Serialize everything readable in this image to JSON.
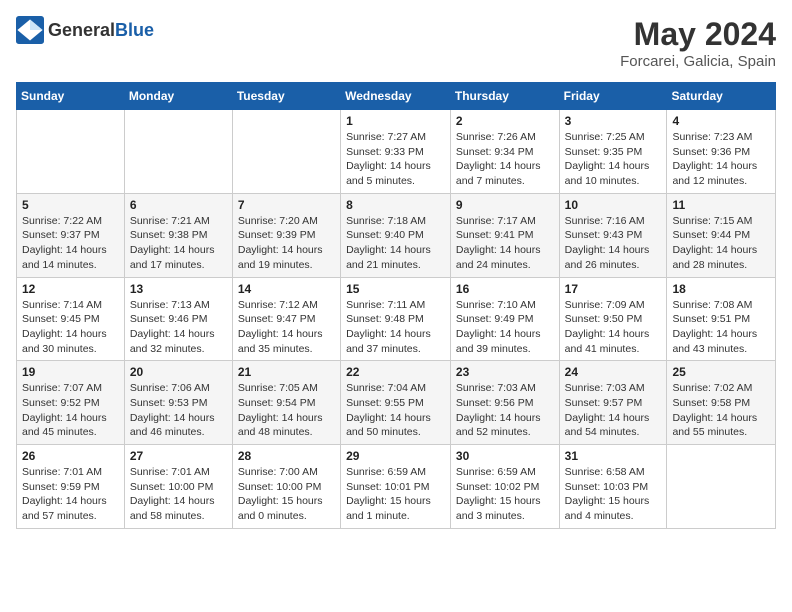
{
  "header": {
    "logo_general": "General",
    "logo_blue": "Blue",
    "month_year": "May 2024",
    "location": "Forcarei, Galicia, Spain"
  },
  "weekdays": [
    "Sunday",
    "Monday",
    "Tuesday",
    "Wednesday",
    "Thursday",
    "Friday",
    "Saturday"
  ],
  "weeks": [
    [
      {
        "day": "",
        "info": ""
      },
      {
        "day": "",
        "info": ""
      },
      {
        "day": "",
        "info": ""
      },
      {
        "day": "1",
        "info": "Sunrise: 7:27 AM\nSunset: 9:33 PM\nDaylight: 14 hours\nand 5 minutes."
      },
      {
        "day": "2",
        "info": "Sunrise: 7:26 AM\nSunset: 9:34 PM\nDaylight: 14 hours\nand 7 minutes."
      },
      {
        "day": "3",
        "info": "Sunrise: 7:25 AM\nSunset: 9:35 PM\nDaylight: 14 hours\nand 10 minutes."
      },
      {
        "day": "4",
        "info": "Sunrise: 7:23 AM\nSunset: 9:36 PM\nDaylight: 14 hours\nand 12 minutes."
      }
    ],
    [
      {
        "day": "5",
        "info": "Sunrise: 7:22 AM\nSunset: 9:37 PM\nDaylight: 14 hours\nand 14 minutes."
      },
      {
        "day": "6",
        "info": "Sunrise: 7:21 AM\nSunset: 9:38 PM\nDaylight: 14 hours\nand 17 minutes."
      },
      {
        "day": "7",
        "info": "Sunrise: 7:20 AM\nSunset: 9:39 PM\nDaylight: 14 hours\nand 19 minutes."
      },
      {
        "day": "8",
        "info": "Sunrise: 7:18 AM\nSunset: 9:40 PM\nDaylight: 14 hours\nand 21 minutes."
      },
      {
        "day": "9",
        "info": "Sunrise: 7:17 AM\nSunset: 9:41 PM\nDaylight: 14 hours\nand 24 minutes."
      },
      {
        "day": "10",
        "info": "Sunrise: 7:16 AM\nSunset: 9:43 PM\nDaylight: 14 hours\nand 26 minutes."
      },
      {
        "day": "11",
        "info": "Sunrise: 7:15 AM\nSunset: 9:44 PM\nDaylight: 14 hours\nand 28 minutes."
      }
    ],
    [
      {
        "day": "12",
        "info": "Sunrise: 7:14 AM\nSunset: 9:45 PM\nDaylight: 14 hours\nand 30 minutes."
      },
      {
        "day": "13",
        "info": "Sunrise: 7:13 AM\nSunset: 9:46 PM\nDaylight: 14 hours\nand 32 minutes."
      },
      {
        "day": "14",
        "info": "Sunrise: 7:12 AM\nSunset: 9:47 PM\nDaylight: 14 hours\nand 35 minutes."
      },
      {
        "day": "15",
        "info": "Sunrise: 7:11 AM\nSunset: 9:48 PM\nDaylight: 14 hours\nand 37 minutes."
      },
      {
        "day": "16",
        "info": "Sunrise: 7:10 AM\nSunset: 9:49 PM\nDaylight: 14 hours\nand 39 minutes."
      },
      {
        "day": "17",
        "info": "Sunrise: 7:09 AM\nSunset: 9:50 PM\nDaylight: 14 hours\nand 41 minutes."
      },
      {
        "day": "18",
        "info": "Sunrise: 7:08 AM\nSunset: 9:51 PM\nDaylight: 14 hours\nand 43 minutes."
      }
    ],
    [
      {
        "day": "19",
        "info": "Sunrise: 7:07 AM\nSunset: 9:52 PM\nDaylight: 14 hours\nand 45 minutes."
      },
      {
        "day": "20",
        "info": "Sunrise: 7:06 AM\nSunset: 9:53 PM\nDaylight: 14 hours\nand 46 minutes."
      },
      {
        "day": "21",
        "info": "Sunrise: 7:05 AM\nSunset: 9:54 PM\nDaylight: 14 hours\nand 48 minutes."
      },
      {
        "day": "22",
        "info": "Sunrise: 7:04 AM\nSunset: 9:55 PM\nDaylight: 14 hours\nand 50 minutes."
      },
      {
        "day": "23",
        "info": "Sunrise: 7:03 AM\nSunset: 9:56 PM\nDaylight: 14 hours\nand 52 minutes."
      },
      {
        "day": "24",
        "info": "Sunrise: 7:03 AM\nSunset: 9:57 PM\nDaylight: 14 hours\nand 54 minutes."
      },
      {
        "day": "25",
        "info": "Sunrise: 7:02 AM\nSunset: 9:58 PM\nDaylight: 14 hours\nand 55 minutes."
      }
    ],
    [
      {
        "day": "26",
        "info": "Sunrise: 7:01 AM\nSunset: 9:59 PM\nDaylight: 14 hours\nand 57 minutes."
      },
      {
        "day": "27",
        "info": "Sunrise: 7:01 AM\nSunset: 10:00 PM\nDaylight: 14 hours\nand 58 minutes."
      },
      {
        "day": "28",
        "info": "Sunrise: 7:00 AM\nSunset: 10:00 PM\nDaylight: 15 hours\nand 0 minutes."
      },
      {
        "day": "29",
        "info": "Sunrise: 6:59 AM\nSunset: 10:01 PM\nDaylight: 15 hours\nand 1 minute."
      },
      {
        "day": "30",
        "info": "Sunrise: 6:59 AM\nSunset: 10:02 PM\nDaylight: 15 hours\nand 3 minutes."
      },
      {
        "day": "31",
        "info": "Sunrise: 6:58 AM\nSunset: 10:03 PM\nDaylight: 15 hours\nand 4 minutes."
      },
      {
        "day": "",
        "info": ""
      }
    ]
  ]
}
